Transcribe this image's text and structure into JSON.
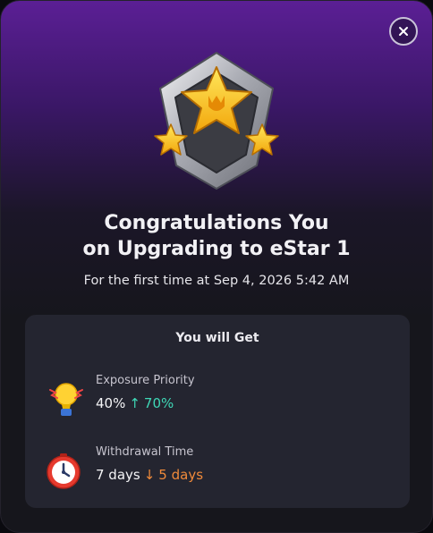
{
  "dialog": {
    "title_line1": "Congratulations You",
    "title_line2": "on Upgrading to eStar 1",
    "subtitle": "For the first time at Sep 4, 2026 5:42 AM",
    "close_icon": "close-icon",
    "badge_icon": "star-shield-badge-icon"
  },
  "benefits": {
    "heading": "You will Get",
    "items": [
      {
        "icon": "lightbulb-icon",
        "label": "Exposure Priority",
        "old_value": "40%",
        "arrow": "↑",
        "new_value": "70%",
        "trend_color": "#3fd7b6"
      },
      {
        "icon": "clock-icon",
        "label": "Withdrawal Time",
        "old_value": "7 days",
        "arrow": "↓",
        "new_value": "5 days",
        "trend_color": "#f08a3a"
      }
    ]
  },
  "colors": {
    "header_purple": "#5b1f95",
    "background": "#16161c",
    "card": "#242530",
    "increase": "#3fd7b6",
    "decrease": "#f08a3a"
  }
}
